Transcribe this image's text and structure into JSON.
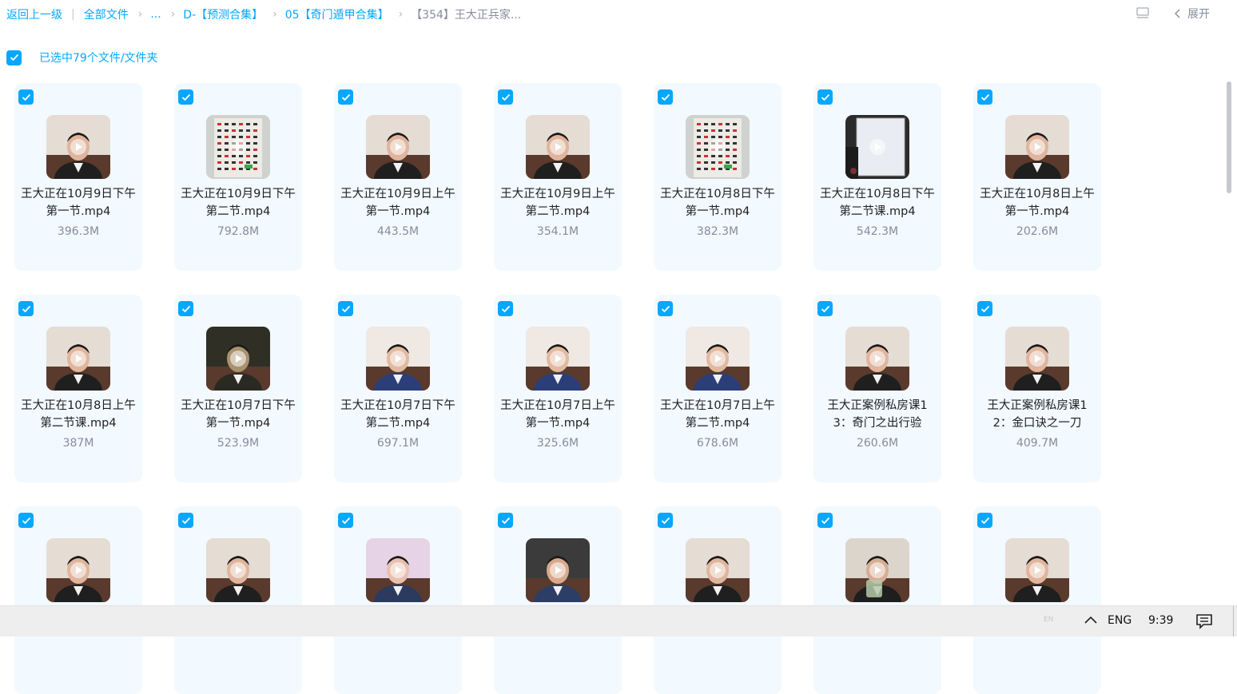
{
  "breadcrumb": {
    "back": "返回上一级",
    "all_files": "全部文件",
    "ellipsis": "...",
    "level1": "D-【预测合集】",
    "level2": "05【奇门遁甲合集】",
    "current": "【354】王大正兵家..."
  },
  "toolbar": {
    "expand_label": "展开",
    "list_icon": "list-view-icon",
    "chevron_icon": "chevron-left-icon"
  },
  "selection": {
    "label": "已选中79个文件/文件夹",
    "checked": true
  },
  "colors": {
    "accent": "#06a7ff",
    "card_bg": "#f2f9ff",
    "muted": "#878c9c"
  },
  "files": [
    {
      "name": "王大正在10月9日下午第一节.mp4",
      "size": "396.3M",
      "thumb": "face-sofa"
    },
    {
      "name": "王大正在10月9日下午第二节.mp4",
      "size": "792.8M",
      "thumb": "board-chart"
    },
    {
      "name": "王大正在10月9日上午第一节.mp4",
      "size": "443.5M",
      "thumb": "face-sofa"
    },
    {
      "name": "王大正在10月9日上午第二节.mp4",
      "size": "354.1M",
      "thumb": "face-sofa"
    },
    {
      "name": "王大正在10月8日下午第一节.mp4",
      "size": "382.3M",
      "thumb": "board-chart"
    },
    {
      "name": "王大正在10月8日下午第二节课.mp4",
      "size": "542.3M",
      "thumb": "whiteboard"
    },
    {
      "name": "王大正在10月8日上午第一节.mp4",
      "size": "202.6M",
      "thumb": "face-sofa"
    },
    {
      "name": "王大正在10月8日上午第二节课.mp4",
      "size": "387M",
      "thumb": "face-sofa"
    },
    {
      "name": "王大正在10月7日下午第一节.mp4",
      "size": "523.9M",
      "thumb": "face-dark"
    },
    {
      "name": "王大正在10月7日下午第二节.mp4",
      "size": "697.1M",
      "thumb": "face-blue"
    },
    {
      "name": "王大正在10月7日上午第一节.mp4",
      "size": "325.6M",
      "thumb": "face-blue"
    },
    {
      "name": "王大正在10月7日上午第二节.mp4",
      "size": "678.6M",
      "thumb": "face-blue"
    },
    {
      "name": "王大正案例私房课13：奇门之出行验",
      "size": "260.6M",
      "thumb": "face-sofa"
    },
    {
      "name": "王大正案例私房课12：金口诀之一刀",
      "size": "409.7M",
      "thumb": "face-sofa"
    },
    {
      "name": "",
      "size": "",
      "thumb": "face-sofa"
    },
    {
      "name": "",
      "size": "",
      "thumb": "face-sofa"
    },
    {
      "name": "",
      "size": "",
      "thumb": "face-pink"
    },
    {
      "name": "",
      "size": "",
      "thumb": "face-street"
    },
    {
      "name": "",
      "size": "",
      "thumb": "face-sofa"
    },
    {
      "name": "",
      "size": "",
      "thumb": "face-cup"
    },
    {
      "name": "",
      "size": "",
      "thumb": "face-sofa"
    }
  ],
  "taskbar": {
    "ime": "EN",
    "lang": "ENG",
    "time": "9:39"
  }
}
